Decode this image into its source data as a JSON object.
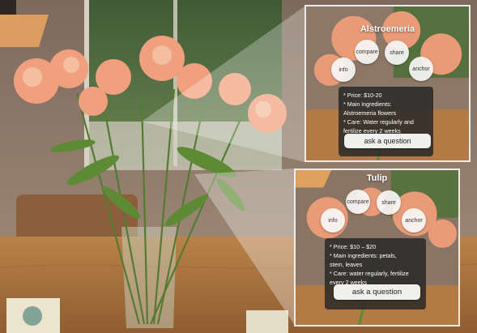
{
  "colors": {
    "card_bg": "#262626",
    "button_bg": "#f8f8f8",
    "text_light": "#ffffff",
    "text_dark": "#222222",
    "panel_border": "#f5f5f5"
  },
  "panels": [
    {
      "title": "Alstroemeria",
      "buttons": {
        "info": "info",
        "compare": "compare",
        "share": "share",
        "anchor": "anchor"
      },
      "details": [
        "* Price: $10-20",
        "* Main ingredients:",
        "Alstroemeria flowers",
        "* Care: Water regularly and",
        "fertilize every 2 weeks"
      ],
      "ask_label": "ask a question"
    },
    {
      "title": "Tulip",
      "buttons": {
        "info": "info",
        "compare": "compare",
        "share": "share",
        "anchor": "anchor"
      },
      "details": [
        "* Price: $10 – $20",
        "* Main ingredients: petals,",
        "stem, leaves",
        "* Care: water regularly, fertilize",
        "every 2 weeks"
      ],
      "ask_label": "ask a question"
    }
  ]
}
